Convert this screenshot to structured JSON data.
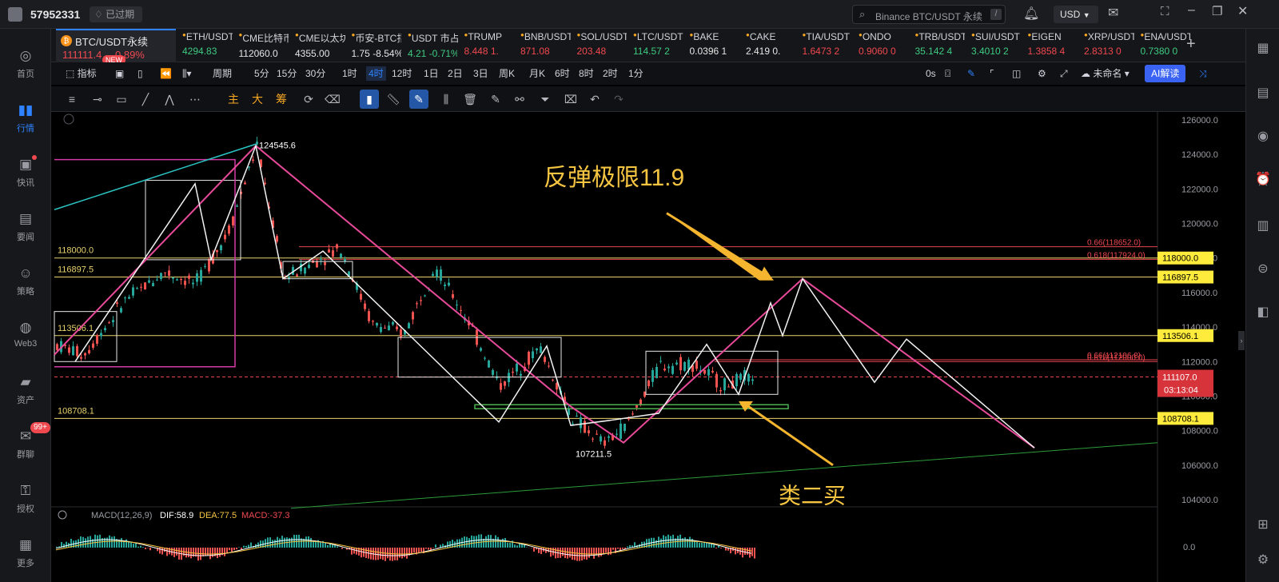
{
  "titlebar": {
    "account_id": "57952331",
    "expired_badge": "已过期",
    "search_placeholder": "Binance BTC/USDT 永续",
    "search_shortcut": "/",
    "currency": "USD"
  },
  "nav": [
    {
      "label": "首页",
      "icon": "home-icon"
    },
    {
      "label": "行情",
      "icon": "market-icon",
      "active": true
    },
    {
      "label": "快讯",
      "icon": "flash-news-icon"
    },
    {
      "label": "要闻",
      "icon": "news-icon"
    },
    {
      "label": "策略",
      "icon": "robot-icon"
    },
    {
      "label": "Web3",
      "icon": "web3-icon"
    },
    {
      "label": "资产",
      "icon": "wallet-icon"
    },
    {
      "label": "群聊",
      "icon": "chat-icon",
      "badge": "99+"
    },
    {
      "label": "授权",
      "icon": "key-icon"
    },
    {
      "label": "更多",
      "icon": "more-icon"
    }
  ],
  "main_ticker": {
    "symbol": "BTC/USDT永续",
    "price": "111111.4",
    "change": "0.89%",
    "new_badge": "NEW"
  },
  "tickers": [
    {
      "name": "ETH/USDT",
      "price": "4294.83",
      "dir": "up"
    },
    {
      "name": "CME比特币",
      "price": "112060.0",
      "dir": "wh"
    },
    {
      "name": "CME以太坊",
      "price": "4355.00",
      "dir": "wh"
    },
    {
      "name": "币安-BTC指数",
      "price": "1.75 -8.54%",
      "dir": "wh"
    },
    {
      "name": "USDT 市占率",
      "price": "4.21 -0.71%",
      "dir": "up"
    },
    {
      "name": "TRUMP",
      "price": "8.448 1.",
      "dir": "dn"
    },
    {
      "name": "BNB/USDT",
      "price": "871.08",
      "dir": "dn"
    },
    {
      "name": "SOL/USDT",
      "price": "203.48",
      "dir": "dn"
    },
    {
      "name": "LTC/USDT",
      "price": "114.57 2",
      "dir": "up"
    },
    {
      "name": "BAKE",
      "price": "0.0396 1",
      "dir": "wh"
    },
    {
      "name": "CAKE",
      "price": "2.419 0.",
      "dir": "wh"
    },
    {
      "name": "TIA/USDT",
      "price": "1.6473 2",
      "dir": "dn"
    },
    {
      "name": "ONDO",
      "price": "0.9060 0",
      "dir": "dn"
    },
    {
      "name": "TRB/USDT",
      "price": "35.142 4",
      "dir": "up"
    },
    {
      "name": "SUI/USDT",
      "price": "3.4010 2",
      "dir": "up"
    },
    {
      "name": "EIGEN",
      "price": "1.3858 4",
      "dir": "dn"
    },
    {
      "name": "XRP/USDT",
      "price": "2.8313 0",
      "dir": "dn"
    },
    {
      "name": "ENA/USDT",
      "price": "0.7380 0",
      "dir": "up"
    }
  ],
  "toolbar": {
    "indicators": "指标",
    "period": "周期",
    "timeframes": [
      "5分",
      "15分",
      "30分",
      "1时",
      "4时",
      "12时",
      "1日",
      "2日",
      "3日",
      "周K",
      "月K",
      "6时",
      "8时",
      "2时",
      "1分"
    ],
    "active_tf": "4时",
    "seconds": "0s",
    "layout_name": "未命名",
    "ai_button": "AI解读",
    "draw_labels": [
      "主",
      "大",
      "筹"
    ]
  },
  "chart": {
    "price_labels": [
      "126000.0",
      "124000.0",
      "122000.0",
      "120000.0",
      "118000.0",
      "116000.0",
      "114000.0",
      "112000.0",
      "110000.0",
      "108000.0",
      "106000.0",
      "104000.0"
    ],
    "level_tags": [
      {
        "text": "118000.0",
        "price": 118000,
        "color": "#ffeb3b"
      },
      {
        "text": "116897.5",
        "price": 116897.5,
        "color": "#ffeb3b"
      },
      {
        "text": "113506.1",
        "price": 113506.1,
        "color": "#ffeb3b"
      },
      {
        "text": "108708.1",
        "price": 108708.1,
        "color": "#ffeb3b"
      }
    ],
    "current_price": "111107.0",
    "countdown": "03:13:04",
    "fib_labels": [
      {
        "text": "0.66(118652.0)",
        "price": 118652
      },
      {
        "text": "0.618(117924.0)",
        "price": 117924
      },
      {
        "text": "0.66(112106.8)",
        "price": 112106.8
      },
      {
        "text": "0.618(112000.0)",
        "price": 112000
      }
    ],
    "left_levels": [
      "118000.0",
      "116897.5",
      "113506.1",
      "108708.1"
    ],
    "high_label": "124545.6",
    "low_label": "107211.5",
    "annotation_top": "反弹极限11.9",
    "annotation_bottom": "类二买",
    "macd": {
      "label": "MACD(12,26,9)",
      "dif": "DIF:58.9",
      "dea": "DEA:77.5",
      "macd": "MACD:-37.3",
      "zero": "0.0"
    }
  }
}
